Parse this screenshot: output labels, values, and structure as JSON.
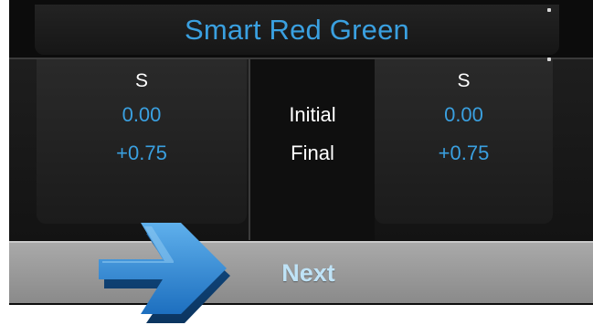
{
  "title": "Smart Red Green",
  "columns": {
    "left": {
      "eye": "S",
      "initial_value": "0.00",
      "final_value": "+0.75"
    },
    "middle": {
      "initial_label": "Initial",
      "final_label": "Final"
    },
    "right": {
      "eye": "S",
      "initial_value": "0.00",
      "final_value": "+0.75"
    }
  },
  "next_button": {
    "label": "Next"
  },
  "overlay": {
    "icon": "arrow-right-icon"
  },
  "colors": {
    "accent": "#3aa0e0",
    "panel_bg": "#0c0c0c",
    "next_bar": "#999999",
    "next_text": "#bfe3f7",
    "arrow": "#1e6fb8"
  }
}
